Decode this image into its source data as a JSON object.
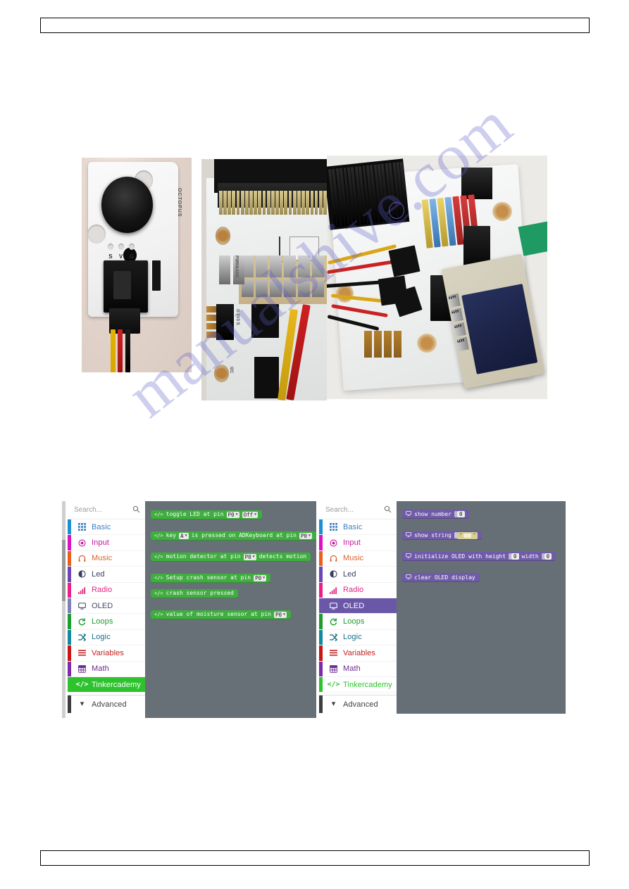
{
  "document": {
    "watermark_text": "manualshive.com",
    "header_bar": "",
    "footer_bar": ""
  },
  "photos": [
    {
      "name": "buzzer-module-photo",
      "caption": "Octopus buzzer module with 3-pin cable connected"
    },
    {
      "name": "breakout-board-photo",
      "caption": "Breakout board header pins with PWM&ADC and I2C labels"
    },
    {
      "name": "oled-wiring-photo",
      "caption": "micro:bit breakout board wired to OLED display"
    }
  ],
  "makecode_left": {
    "search": {
      "placeholder": "Search...",
      "icon": "search-icon"
    },
    "categories": [
      {
        "label": "Basic",
        "icon": "grid-icon",
        "color": "#1e90d2",
        "text_color": "#3e7fbf",
        "selected": false
      },
      {
        "label": "Input",
        "icon": "target-icon",
        "color": "#d912c6",
        "text_color": "#c5169e",
        "selected": false
      },
      {
        "label": "Music",
        "icon": "headphone-icon",
        "color": "#e8601c",
        "text_color": "#d9622a",
        "selected": false
      },
      {
        "label": "Led",
        "icon": "contrast-icon",
        "color": "#6a46b5",
        "text_color": "#3c3c60",
        "selected": false
      },
      {
        "label": "Radio",
        "icon": "signal-icon",
        "color": "#ec1d89",
        "text_color": "#e0257f",
        "selected": false
      },
      {
        "label": "OLED",
        "icon": "monitor-icon",
        "color": "#7f7fb8",
        "text_color": "#4a4a6a",
        "selected": false
      },
      {
        "label": "Loops",
        "icon": "loop-icon",
        "color": "#1e9c2e",
        "text_color": "#1e9c2e",
        "selected": false
      },
      {
        "label": "Logic",
        "icon": "shuffle-icon",
        "color": "#128a9e",
        "text_color": "#1a6f85",
        "selected": false
      },
      {
        "label": "Variables",
        "icon": "lines-icon",
        "color": "#c81515",
        "text_color": "#c22020",
        "selected": false
      },
      {
        "label": "Math",
        "icon": "calc-icon",
        "color": "#7c2aa8",
        "text_color": "#6a2c91",
        "selected": false
      },
      {
        "label": "Tinkercademy",
        "icon": "code-icon",
        "color": "#2ec22e",
        "text_color": "#ffffff",
        "selected": true
      }
    ],
    "advanced": {
      "label": "Advanced",
      "icon": "chevron-down-icon"
    },
    "blocks": [
      {
        "id": "toggle-led",
        "text_before": "toggle LED at pin",
        "dropdowns": [
          "P0",
          "Off"
        ],
        "text_after": ""
      },
      {
        "id": "adkeyboard",
        "text_before": "key",
        "dropdowns": [
          "A"
        ],
        "text_mid": "is pressed on ADKeyboard at pin",
        "dropdowns2": [
          "P0"
        ]
      },
      {
        "id": "motion",
        "text_before": "motion detector at pin",
        "dropdowns": [
          "P0"
        ],
        "text_after": "detects motion"
      },
      {
        "id": "setup-crash",
        "text_before": "Setup crash sensor at pin",
        "dropdowns": [
          "P0"
        ],
        "text_after": ""
      },
      {
        "id": "crash-pressed",
        "text_before": "crash sensor pressed",
        "dropdowns": [],
        "text_after": ""
      },
      {
        "id": "moisture",
        "text_before": "value of moisture sensor at pin",
        "dropdowns": [
          "P0"
        ],
        "text_after": ""
      }
    ]
  },
  "makecode_right": {
    "search": {
      "placeholder": "Search...",
      "icon": "search-icon"
    },
    "categories": [
      {
        "label": "Basic",
        "icon": "grid-icon",
        "color": "#1e90d2",
        "text_color": "#3e7fbf",
        "selected": false
      },
      {
        "label": "Input",
        "icon": "target-icon",
        "color": "#d912c6",
        "text_color": "#c5169e",
        "selected": false
      },
      {
        "label": "Music",
        "icon": "headphone-icon",
        "color": "#e8601c",
        "text_color": "#d9622a",
        "selected": false
      },
      {
        "label": "Led",
        "icon": "contrast-icon",
        "color": "#6a46b5",
        "text_color": "#3c3c60",
        "selected": false
      },
      {
        "label": "Radio",
        "icon": "signal-icon",
        "color": "#ec1d89",
        "text_color": "#e0257f",
        "selected": false
      },
      {
        "label": "OLED",
        "icon": "monitor-icon",
        "color": "#6b57a8",
        "text_color": "#ffffff",
        "selected": true
      },
      {
        "label": "Loops",
        "icon": "loop-icon",
        "color": "#1e9c2e",
        "text_color": "#1e9c2e",
        "selected": false
      },
      {
        "label": "Logic",
        "icon": "shuffle-icon",
        "color": "#128a9e",
        "text_color": "#1a6f85",
        "selected": false
      },
      {
        "label": "Variables",
        "icon": "lines-icon",
        "color": "#c81515",
        "text_color": "#c22020",
        "selected": false
      },
      {
        "label": "Math",
        "icon": "calc-icon",
        "color": "#7c2aa8",
        "text_color": "#6a2c91",
        "selected": false
      },
      {
        "label": "Tinkercademy",
        "icon": "code-icon",
        "color": "#2ec22e",
        "text_color": "#2ec22e",
        "selected": false
      }
    ],
    "advanced": {
      "label": "Advanced",
      "icon": "chevron-down-icon"
    },
    "blocks": [
      {
        "id": "show-number",
        "text_before": "show number",
        "value": "0"
      },
      {
        "id": "show-string",
        "text_before": "show string",
        "value": ""
      },
      {
        "id": "initialize-oled",
        "text_before": "initialize OLED with height",
        "value": "0",
        "text_mid": "width",
        "value2": "0"
      },
      {
        "id": "clear-oled",
        "text_before": "clear OLED display",
        "value": null
      }
    ]
  }
}
